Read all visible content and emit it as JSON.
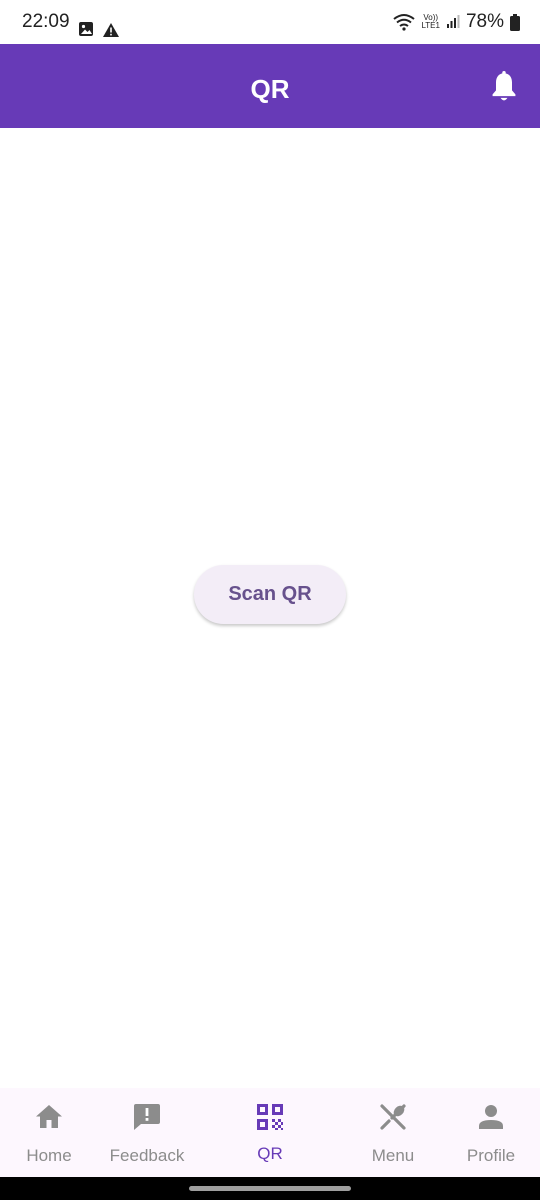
{
  "status_bar": {
    "time": "22:09",
    "network_label_top": "Vo))",
    "network_label_bottom": "LTE1",
    "battery_percent": "78%",
    "left_icons": [
      "image-icon",
      "warning-icon"
    ],
    "right_icons": [
      "wifi-icon",
      "signal-icon",
      "battery-icon"
    ]
  },
  "app_bar": {
    "title": "QR",
    "action_icon": "bell-icon",
    "background": "#673ab7"
  },
  "main": {
    "scan_button_label": "Scan QR"
  },
  "bottom_nav": {
    "items": [
      {
        "label": "Home",
        "icon": "home-icon",
        "active": false
      },
      {
        "label": "Feedback",
        "icon": "feedback-icon",
        "active": false
      },
      {
        "label": "QR",
        "icon": "qr-code-icon",
        "active": true
      },
      {
        "label": "Menu",
        "icon": "restaurant-icon",
        "active": false
      },
      {
        "label": "Profile",
        "icon": "person-icon",
        "active": false
      }
    ],
    "active_color": "#673ab7",
    "inactive_color": "#8c8c8c"
  }
}
